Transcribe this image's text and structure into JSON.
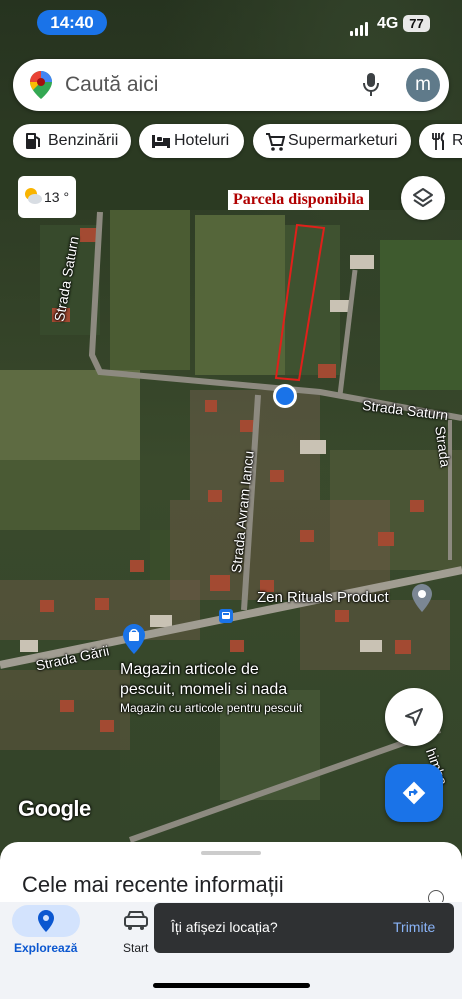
{
  "status": {
    "time": "14:40",
    "network": "4G",
    "battery": "77"
  },
  "search": {
    "placeholder": "Caută aici",
    "avatar_letter": "m"
  },
  "chips": [
    {
      "label": "Benzinării",
      "icon": "gas-station-icon"
    },
    {
      "label": "Hoteluri",
      "icon": "bed-icon"
    },
    {
      "label": "Supermarketuri",
      "icon": "cart-icon"
    },
    {
      "label": "R",
      "icon": "restaurant-icon"
    }
  ],
  "weather": {
    "temp": "13 °",
    "icon": "partly-sunny-icon"
  },
  "map": {
    "parcel_label": "Parcela disponibila",
    "streets": {
      "saturn_vertical": "Strada Saturn",
      "saturn_horizontal": "Strada Saturn",
      "avram_iancu": "Strada Avram Iancu",
      "garii": "Strada Gării",
      "edge_right": "Strada",
      "edge_right2": "himba"
    },
    "places": {
      "zen": "Zen Rituals Product",
      "shop_name_line1": "Magazin articole de",
      "shop_name_line2": "pescuit, momeli si nada",
      "shop_desc": "Magazin cu articole pentru pescuit"
    },
    "attribution": "Google",
    "colors": {
      "parcel_outline": "#e0201a",
      "location_dot": "#1a73e8",
      "parcel_label_text": "#b00000"
    }
  },
  "sheet": {
    "title": "Cele mai recente informații"
  },
  "nav": [
    {
      "label": "Explorează",
      "icon": "location-pin-icon",
      "active": true
    },
    {
      "label": "Start",
      "icon": "car-icon",
      "active": false
    }
  ],
  "toast": {
    "message": "Îți afișezi locația?",
    "action": "Trimite"
  }
}
